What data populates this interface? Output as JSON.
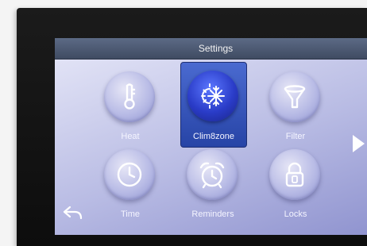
{
  "header": {
    "title": "Settings"
  },
  "menu": {
    "heat_label": "Heat",
    "clim8zone_label": "Clim8zone",
    "filter_label": "Filter",
    "time_label": "Time",
    "reminders_label": "Reminders",
    "locks_label": "Locks"
  },
  "icons": {
    "heat": "thermometer-icon",
    "clim8zone": "snowflake-sun-icon",
    "filter": "filter-funnel-icon",
    "time": "clock-icon",
    "reminders": "alarm-clock-icon",
    "locks": "padlock-icon",
    "next": "play-arrow-icon",
    "back": "back-arrow-icon"
  },
  "colors": {
    "title_bar": "#4f5b74",
    "screen_bg": "#b9bce4",
    "selected": "#2f4fb8"
  }
}
